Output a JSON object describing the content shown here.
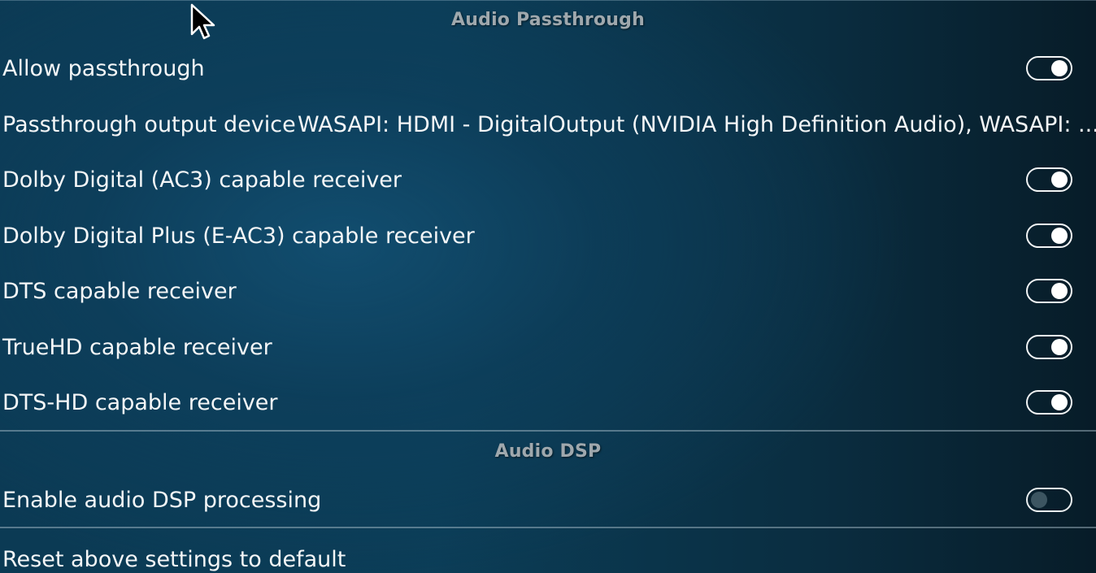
{
  "sections": [
    {
      "title": "Audio Passthrough",
      "items": [
        {
          "label": "Allow passthrough",
          "type": "toggle",
          "state": "on"
        },
        {
          "label": "Passthrough output device",
          "type": "value",
          "value": "WASAPI: HDMI - DigitalOutput (NVIDIA High Definition Audio), WASAPI: ..."
        },
        {
          "label": "Dolby Digital (AC3) capable receiver",
          "type": "toggle",
          "state": "on"
        },
        {
          "label": "Dolby Digital Plus (E-AC3) capable receiver",
          "type": "toggle",
          "state": "on"
        },
        {
          "label": "DTS capable receiver",
          "type": "toggle",
          "state": "on"
        },
        {
          "label": "TrueHD capable receiver",
          "type": "toggle",
          "state": "on"
        },
        {
          "label": "DTS-HD capable receiver",
          "type": "toggle",
          "state": "on"
        }
      ]
    },
    {
      "title": "Audio DSP",
      "items": [
        {
          "label": "Enable audio DSP processing",
          "type": "toggle",
          "state": "off"
        }
      ]
    }
  ],
  "reset": {
    "label": "Reset above settings to default"
  },
  "icons": {
    "cursor": "mouse-pointer-icon"
  }
}
